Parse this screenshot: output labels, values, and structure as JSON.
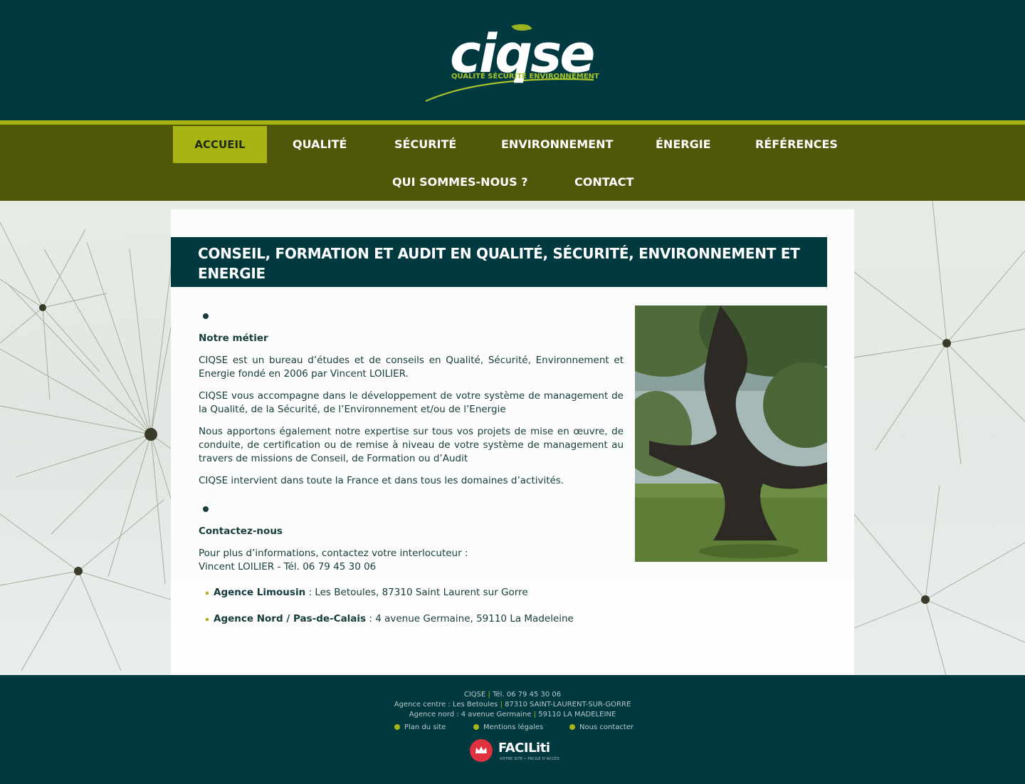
{
  "brand": {
    "logo_word": "ciqse",
    "logo_tagline": "QUALITÉ SÉCURITÉ ENVIRONNEMENT",
    "colors": {
      "dark_teal": "#003a40",
      "olive": "#515708",
      "lime": "#a8b414",
      "red": "#e0313f"
    }
  },
  "nav": {
    "items": [
      {
        "label": "ACCUEIL",
        "active": true
      },
      {
        "label": "QUALITÉ"
      },
      {
        "label": "SÉCURITÉ"
      },
      {
        "label": "ENVIRONNEMENT"
      },
      {
        "label": "ÉNERGIE"
      },
      {
        "label": "RÉFÉRENCES"
      },
      {
        "label": "QUI SOMMES-NOUS ?"
      },
      {
        "label": "CONTACT"
      }
    ]
  },
  "main": {
    "title": "CONSEIL, FORMATION ET AUDIT EN QUALITÉ, SÉCURITÉ, ENVIRONNEMENT ET ENERGIE",
    "section1": {
      "heading": "Notre métier",
      "paragraphs": [
        "CIQSE est un bureau d’études et de conseils en Qualité, Sécurité, Environnement et Energie fondé en 2006 par Vincent LOILIER.",
        "CIQSE vous accompagne dans le développement de votre système de management de la Qualité, de la Sécurité, de l’Environnement et/ou de l’Energie",
        "Nous apportons également notre expertise sur tous vos projets de mise en œuvre, de conduite, de certification ou de remise à niveau de votre système de management au travers de missions de Conseil, de Formation ou d’Audit",
        "CIQSE intervient dans toute la France et dans tous les domaines d’activités."
      ]
    },
    "section2": {
      "heading": "Contactez-nous",
      "intro_line1": "Pour plus d’informations, contactez votre interlocuteur :",
      "intro_line2": "Vincent LOILIER - Tél. 06 79 45 30 06",
      "agencies": [
        {
          "name": "Agence Limousin",
          "address": " : Les Betoules, 87310 Saint Laurent sur Gorre"
        },
        {
          "name": "Agence Nord / Pas-de-Calais",
          "address": " : 4 avenue Germaine, 59110 La Madeleine"
        }
      ]
    },
    "photo_icon": "tree-photo"
  },
  "footer": {
    "company": "CIQSE",
    "phone": "Tél. 06 79 45 30 06",
    "agency_centre_label": "Agence centre : Les Betoules",
    "agency_centre_city": "87310 SAINT-LAURENT-SUR-GORRE",
    "agency_nord_label": "Agence nord : 4 avenue Germaine",
    "agency_nord_city": "59110 LA MADELEINE",
    "sep": "|",
    "links": [
      "Plan du site",
      "Mentions légales",
      "Nous contacter"
    ],
    "faciliti": {
      "word": "FACILiti",
      "sub": "VOTRE SITE • FACILE D’ACCÈS"
    }
  }
}
